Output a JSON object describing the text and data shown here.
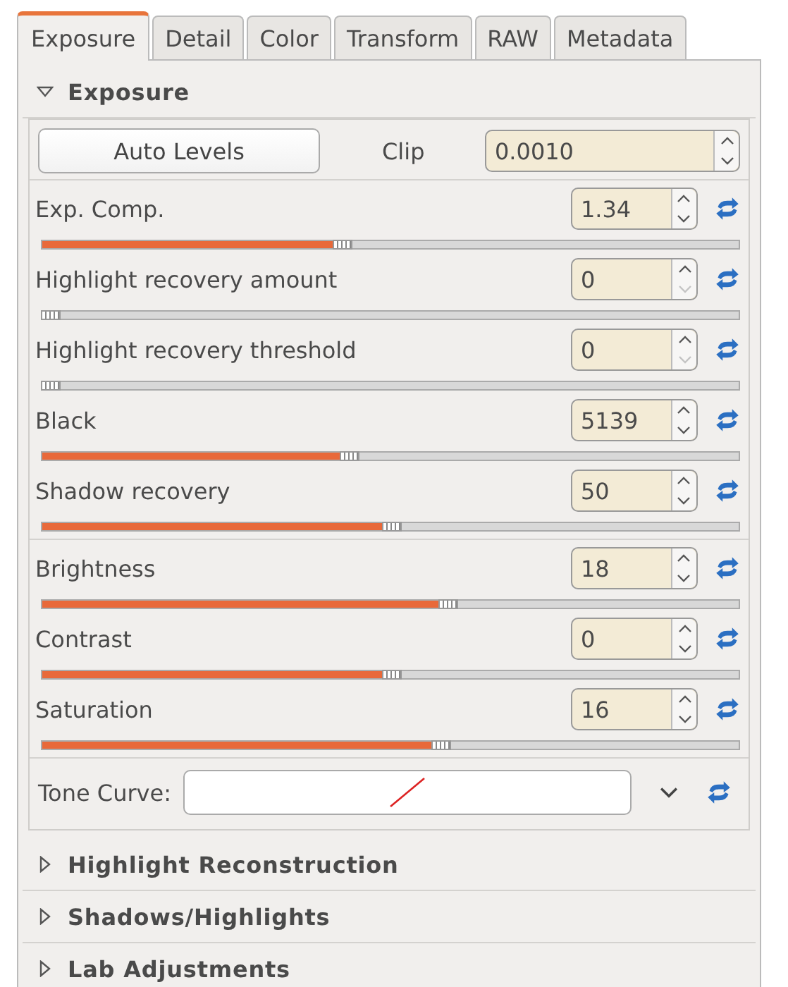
{
  "tabs": [
    {
      "label": "Exposure",
      "selected": true
    },
    {
      "label": "Detail",
      "selected": false
    },
    {
      "label": "Color",
      "selected": false
    },
    {
      "label": "Transform",
      "selected": false
    },
    {
      "label": "RAW",
      "selected": false
    },
    {
      "label": "Metadata",
      "selected": false
    }
  ],
  "sections": [
    {
      "title": "Exposure",
      "expanded": true
    },
    {
      "title": "Highlight Reconstruction",
      "expanded": false
    },
    {
      "title": "Shadows/Highlights",
      "expanded": false
    },
    {
      "title": "Lab Adjustments",
      "expanded": false
    }
  ],
  "auto_levels": {
    "button": "Auto Levels",
    "clip_label": "Clip",
    "clip_value": "0.0010"
  },
  "slider_groups": [
    [
      {
        "label": "Exp. Comp.",
        "value": "1.34",
        "level": 0.42,
        "down_disabled": false
      },
      {
        "label": "Highlight recovery amount",
        "value": "0",
        "level": 0,
        "down_disabled": true
      },
      {
        "label": "Highlight recovery threshold",
        "value": "0",
        "level": 0,
        "down_disabled": true
      },
      {
        "label": "Black",
        "value": "5139",
        "level": 0.43,
        "down_disabled": false
      },
      {
        "label": "Shadow recovery",
        "value": "50",
        "level": 0.49,
        "down_disabled": false
      }
    ],
    [
      {
        "label": "Brightness",
        "value": "18",
        "level": 0.57,
        "down_disabled": false
      },
      {
        "label": "Contrast",
        "value": "0",
        "level": 0.49,
        "down_disabled": false
      },
      {
        "label": "Saturation",
        "value": "16",
        "level": 0.56,
        "down_disabled": false
      }
    ]
  ],
  "tone_curve": {
    "label": "Tone Curve:"
  }
}
